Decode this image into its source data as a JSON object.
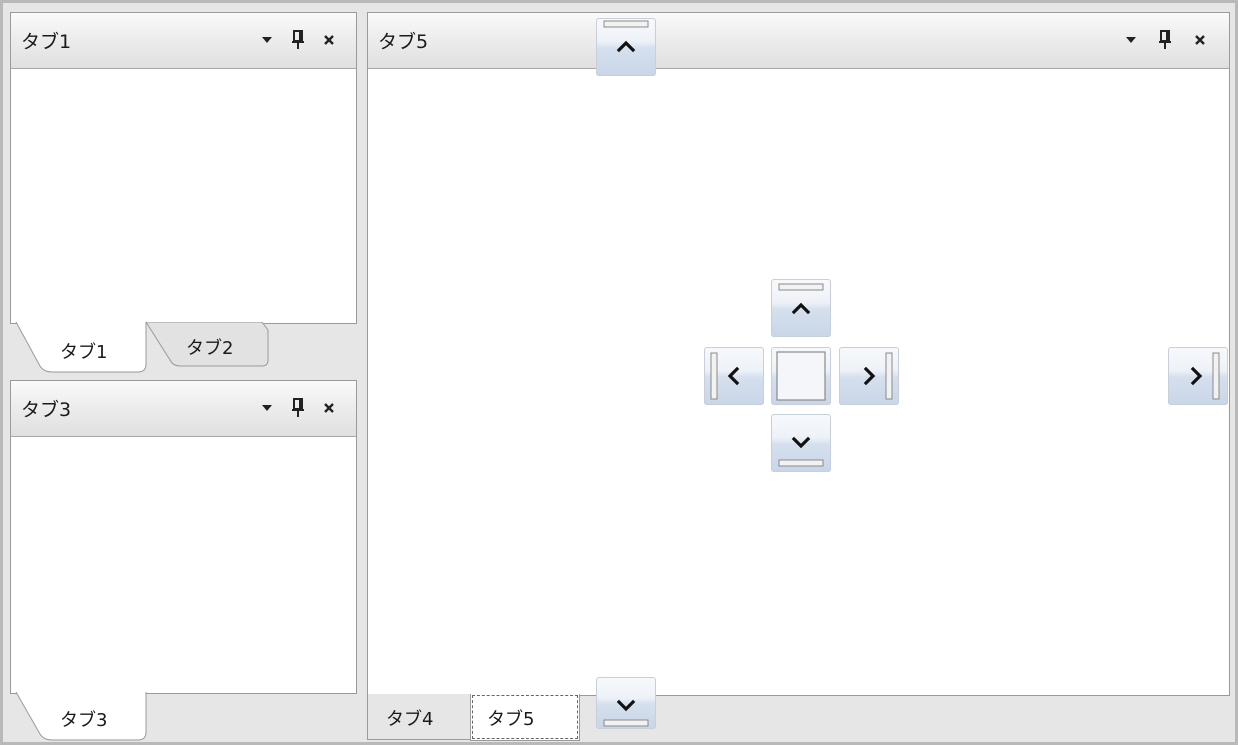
{
  "panes": {
    "pane1": {
      "title": "タブ1",
      "tabs": [
        {
          "label": "タブ1",
          "active": true
        },
        {
          "label": "タブ2",
          "active": false
        }
      ]
    },
    "pane3": {
      "title": "タブ3",
      "tabs": [
        {
          "label": "タブ3",
          "active": true
        }
      ]
    },
    "pane5": {
      "title": "タブ5",
      "tabs": [
        {
          "label": "タブ4",
          "active": false
        },
        {
          "label": "タブ5",
          "active": true
        }
      ]
    }
  },
  "header_icons": [
    "dropdown-icon",
    "pin-icon",
    "close-icon"
  ],
  "dock_guides": {
    "top_edge": "dock-top-icon",
    "bottom_edge": "dock-bottom-icon",
    "right_edge": "dock-right-icon",
    "center_compass": [
      "dock-top-icon",
      "dock-left-icon",
      "dock-center-icon",
      "dock-right-icon",
      "dock-bottom-icon"
    ]
  },
  "colors": {
    "header_top": "#fafafa",
    "header_bottom": "#e0e0e0",
    "dock_guide_top": "#f7f9fc",
    "dock_guide_bottom": "#c9d6e8",
    "pane_border": "#9a9a9a",
    "background": "#e6e6e6"
  }
}
